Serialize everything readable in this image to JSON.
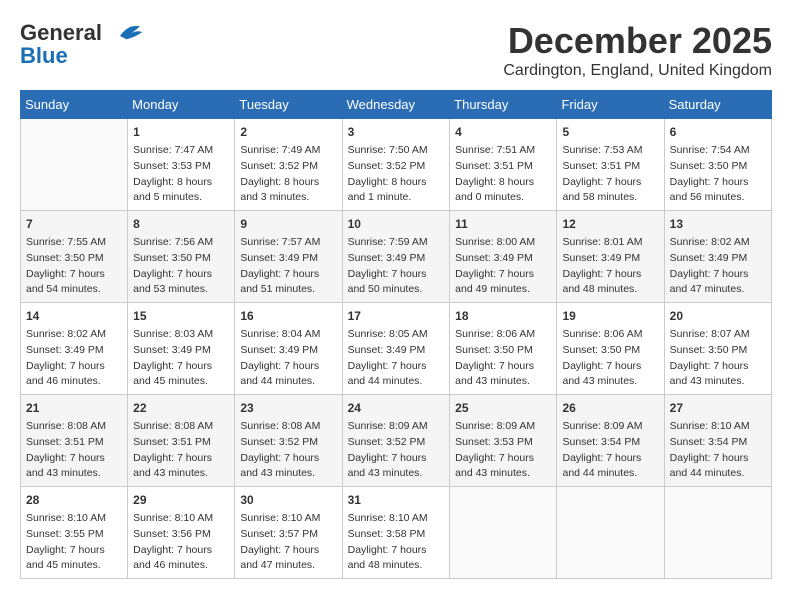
{
  "header": {
    "logo_line1": "General",
    "logo_line2": "Blue",
    "month": "December 2025",
    "location": "Cardington, England, United Kingdom"
  },
  "days_of_week": [
    "Sunday",
    "Monday",
    "Tuesday",
    "Wednesday",
    "Thursday",
    "Friday",
    "Saturday"
  ],
  "weeks": [
    [
      {
        "day": "",
        "sunrise": "",
        "sunset": "",
        "daylight": ""
      },
      {
        "day": "1",
        "sunrise": "Sunrise: 7:47 AM",
        "sunset": "Sunset: 3:53 PM",
        "daylight": "Daylight: 8 hours and 5 minutes."
      },
      {
        "day": "2",
        "sunrise": "Sunrise: 7:49 AM",
        "sunset": "Sunset: 3:52 PM",
        "daylight": "Daylight: 8 hours and 3 minutes."
      },
      {
        "day": "3",
        "sunrise": "Sunrise: 7:50 AM",
        "sunset": "Sunset: 3:52 PM",
        "daylight": "Daylight: 8 hours and 1 minute."
      },
      {
        "day": "4",
        "sunrise": "Sunrise: 7:51 AM",
        "sunset": "Sunset: 3:51 PM",
        "daylight": "Daylight: 8 hours and 0 minutes."
      },
      {
        "day": "5",
        "sunrise": "Sunrise: 7:53 AM",
        "sunset": "Sunset: 3:51 PM",
        "daylight": "Daylight: 7 hours and 58 minutes."
      },
      {
        "day": "6",
        "sunrise": "Sunrise: 7:54 AM",
        "sunset": "Sunset: 3:50 PM",
        "daylight": "Daylight: 7 hours and 56 minutes."
      }
    ],
    [
      {
        "day": "7",
        "sunrise": "Sunrise: 7:55 AM",
        "sunset": "Sunset: 3:50 PM",
        "daylight": "Daylight: 7 hours and 54 minutes."
      },
      {
        "day": "8",
        "sunrise": "Sunrise: 7:56 AM",
        "sunset": "Sunset: 3:50 PM",
        "daylight": "Daylight: 7 hours and 53 minutes."
      },
      {
        "day": "9",
        "sunrise": "Sunrise: 7:57 AM",
        "sunset": "Sunset: 3:49 PM",
        "daylight": "Daylight: 7 hours and 51 minutes."
      },
      {
        "day": "10",
        "sunrise": "Sunrise: 7:59 AM",
        "sunset": "Sunset: 3:49 PM",
        "daylight": "Daylight: 7 hours and 50 minutes."
      },
      {
        "day": "11",
        "sunrise": "Sunrise: 8:00 AM",
        "sunset": "Sunset: 3:49 PM",
        "daylight": "Daylight: 7 hours and 49 minutes."
      },
      {
        "day": "12",
        "sunrise": "Sunrise: 8:01 AM",
        "sunset": "Sunset: 3:49 PM",
        "daylight": "Daylight: 7 hours and 48 minutes."
      },
      {
        "day": "13",
        "sunrise": "Sunrise: 8:02 AM",
        "sunset": "Sunset: 3:49 PM",
        "daylight": "Daylight: 7 hours and 47 minutes."
      }
    ],
    [
      {
        "day": "14",
        "sunrise": "Sunrise: 8:02 AM",
        "sunset": "Sunset: 3:49 PM",
        "daylight": "Daylight: 7 hours and 46 minutes."
      },
      {
        "day": "15",
        "sunrise": "Sunrise: 8:03 AM",
        "sunset": "Sunset: 3:49 PM",
        "daylight": "Daylight: 7 hours and 45 minutes."
      },
      {
        "day": "16",
        "sunrise": "Sunrise: 8:04 AM",
        "sunset": "Sunset: 3:49 PM",
        "daylight": "Daylight: 7 hours and 44 minutes."
      },
      {
        "day": "17",
        "sunrise": "Sunrise: 8:05 AM",
        "sunset": "Sunset: 3:49 PM",
        "daylight": "Daylight: 7 hours and 44 minutes."
      },
      {
        "day": "18",
        "sunrise": "Sunrise: 8:06 AM",
        "sunset": "Sunset: 3:50 PM",
        "daylight": "Daylight: 7 hours and 43 minutes."
      },
      {
        "day": "19",
        "sunrise": "Sunrise: 8:06 AM",
        "sunset": "Sunset: 3:50 PM",
        "daylight": "Daylight: 7 hours and 43 minutes."
      },
      {
        "day": "20",
        "sunrise": "Sunrise: 8:07 AM",
        "sunset": "Sunset: 3:50 PM",
        "daylight": "Daylight: 7 hours and 43 minutes."
      }
    ],
    [
      {
        "day": "21",
        "sunrise": "Sunrise: 8:08 AM",
        "sunset": "Sunset: 3:51 PM",
        "daylight": "Daylight: 7 hours and 43 minutes."
      },
      {
        "day": "22",
        "sunrise": "Sunrise: 8:08 AM",
        "sunset": "Sunset: 3:51 PM",
        "daylight": "Daylight: 7 hours and 43 minutes."
      },
      {
        "day": "23",
        "sunrise": "Sunrise: 8:08 AM",
        "sunset": "Sunset: 3:52 PM",
        "daylight": "Daylight: 7 hours and 43 minutes."
      },
      {
        "day": "24",
        "sunrise": "Sunrise: 8:09 AM",
        "sunset": "Sunset: 3:52 PM",
        "daylight": "Daylight: 7 hours and 43 minutes."
      },
      {
        "day": "25",
        "sunrise": "Sunrise: 8:09 AM",
        "sunset": "Sunset: 3:53 PM",
        "daylight": "Daylight: 7 hours and 43 minutes."
      },
      {
        "day": "26",
        "sunrise": "Sunrise: 8:09 AM",
        "sunset": "Sunset: 3:54 PM",
        "daylight": "Daylight: 7 hours and 44 minutes."
      },
      {
        "day": "27",
        "sunrise": "Sunrise: 8:10 AM",
        "sunset": "Sunset: 3:54 PM",
        "daylight": "Daylight: 7 hours and 44 minutes."
      }
    ],
    [
      {
        "day": "28",
        "sunrise": "Sunrise: 8:10 AM",
        "sunset": "Sunset: 3:55 PM",
        "daylight": "Daylight: 7 hours and 45 minutes."
      },
      {
        "day": "29",
        "sunrise": "Sunrise: 8:10 AM",
        "sunset": "Sunset: 3:56 PM",
        "daylight": "Daylight: 7 hours and 46 minutes."
      },
      {
        "day": "30",
        "sunrise": "Sunrise: 8:10 AM",
        "sunset": "Sunset: 3:57 PM",
        "daylight": "Daylight: 7 hours and 47 minutes."
      },
      {
        "day": "31",
        "sunrise": "Sunrise: 8:10 AM",
        "sunset": "Sunset: 3:58 PM",
        "daylight": "Daylight: 7 hours and 48 minutes."
      },
      {
        "day": "",
        "sunrise": "",
        "sunset": "",
        "daylight": ""
      },
      {
        "day": "",
        "sunrise": "",
        "sunset": "",
        "daylight": ""
      },
      {
        "day": "",
        "sunrise": "",
        "sunset": "",
        "daylight": ""
      }
    ]
  ]
}
